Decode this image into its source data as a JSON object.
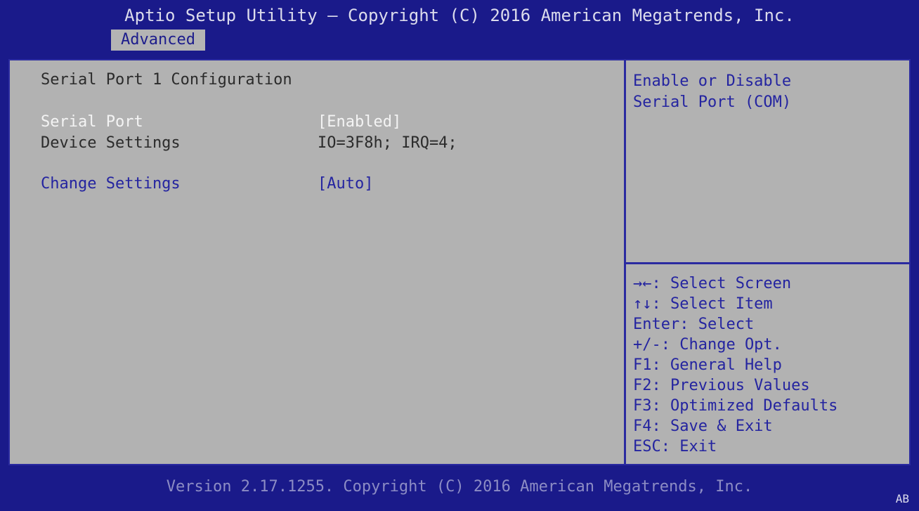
{
  "header": {
    "title": "Aptio Setup Utility – Copyright (C) 2016 American Megatrends, Inc.",
    "tabs": [
      {
        "label": "Advanced"
      }
    ]
  },
  "main": {
    "section_title": "Serial Port 1 Configuration",
    "rows": [
      {
        "label": "Serial Port",
        "value": "[Enabled]"
      },
      {
        "label": "Device Settings",
        "value": "IO=3F8h; IRQ=4;"
      },
      {
        "label": "Change Settings",
        "value": "[Auto]"
      }
    ]
  },
  "help": {
    "line1": "Enable or Disable",
    "line2": "Serial Port (COM)"
  },
  "keys": [
    "→←: Select Screen",
    "↑↓: Select Item",
    "Enter: Select",
    "+/-: Change Opt.",
    "F1: General Help",
    "F2: Previous Values",
    "F3: Optimized Defaults",
    "F4: Save & Exit",
    "ESC: Exit"
  ],
  "footer": {
    "text": "Version 2.17.1255. Copyright (C) 2016 American Megatrends, Inc.",
    "badge": "AB"
  },
  "colors": {
    "background": "#1a1a8a",
    "panel": "#b2b2b2",
    "highlight_text": "#f4f4f4",
    "selectable_text": "#2424a0",
    "static_text": "#2b2b2b"
  }
}
